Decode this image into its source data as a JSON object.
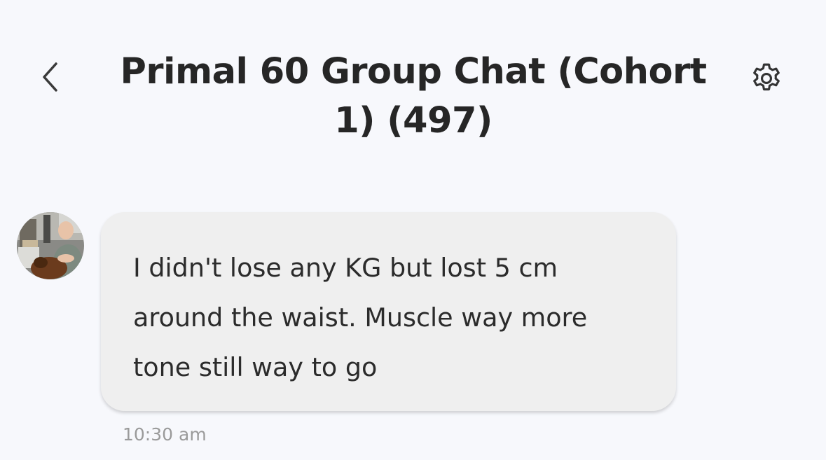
{
  "header": {
    "back_icon": "chevron-left-icon",
    "title": "Primal 60 Group Chat (Cohort 1) (497)",
    "settings_icon": "gear-icon"
  },
  "message": {
    "avatar": "user-avatar-photo",
    "text": "I didn't lose any KG but lost 5 cm around the waist. Muscle way more tone still way to go",
    "time": "10:30 am"
  },
  "colors": {
    "background": "#f7f8fc",
    "bubble": "#efefef",
    "title_text": "#262626",
    "timestamp": "#9a9a9a"
  }
}
